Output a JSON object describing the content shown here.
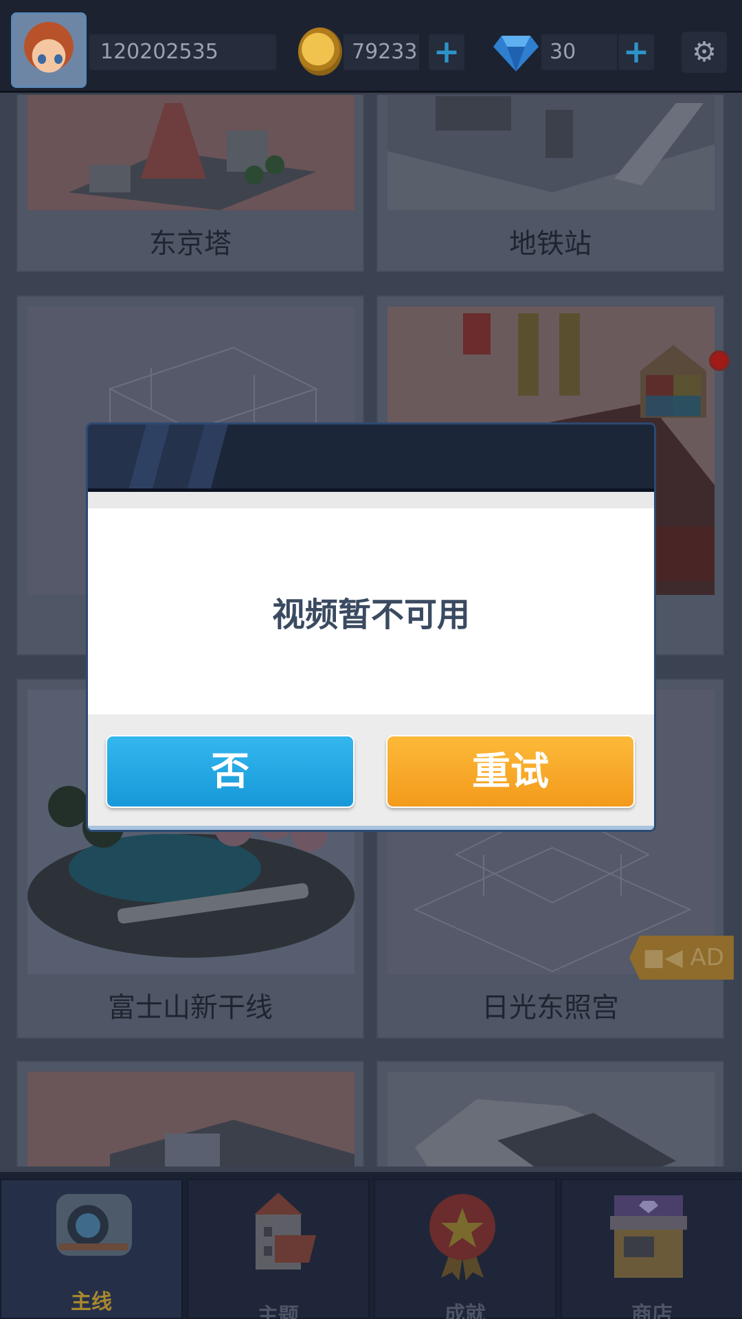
{
  "header": {
    "user_id": "120202535",
    "coins": "79233",
    "gems": "30",
    "add_label": "+"
  },
  "cards": [
    {
      "label": "东京塔"
    },
    {
      "label": "地铁站"
    },
    {
      "label": ""
    },
    {
      "label": ""
    },
    {
      "label": "富士山新干线"
    },
    {
      "label": "日光东照宫"
    }
  ],
  "ad_tag": "AD",
  "dialog": {
    "message": "视频暂不可用",
    "no_label": "否",
    "retry_label": "重试"
  },
  "nav": {
    "tabs": [
      {
        "label": "主线",
        "active": true
      },
      {
        "label": "主题",
        "active": false
      },
      {
        "label": "成就",
        "active": false
      },
      {
        "label": "商店",
        "active": false
      }
    ]
  },
  "colors": {
    "no_button": "#1a9fdc",
    "retry_button": "#f6a423",
    "active_tab_text": "#a8872e"
  }
}
